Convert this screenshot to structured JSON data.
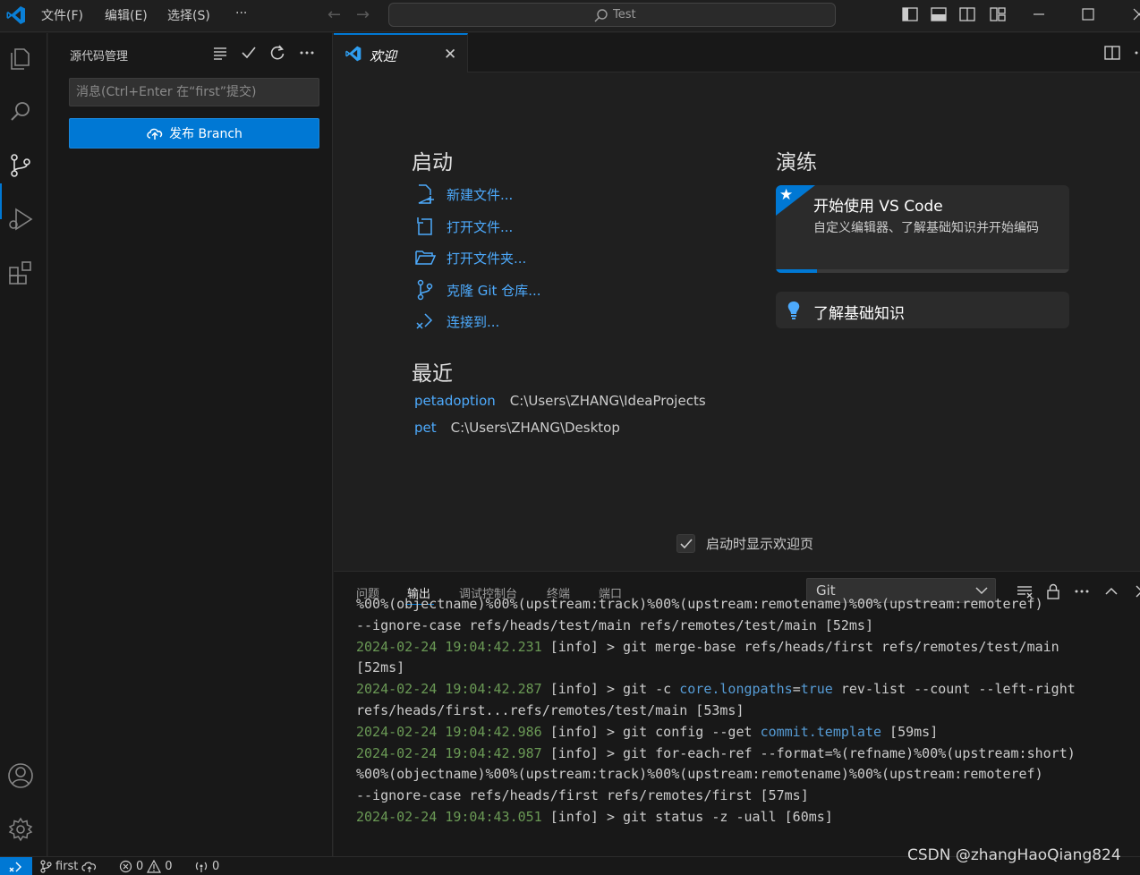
{
  "titlebar": {
    "menu": [
      "文件(F)",
      "编辑(E)",
      "选择(S)",
      "···"
    ],
    "search_text": "Test"
  },
  "sidebar": {
    "title": "源代码管理",
    "message_placeholder": "消息(Ctrl+Enter 在“first”提交)",
    "publish_label": "发布 Branch"
  },
  "tabs": {
    "welcome_label": "欢迎"
  },
  "welcome": {
    "start_title": "启动",
    "start_items": [
      "新建文件...",
      "打开文件...",
      "打开文件夹...",
      "克隆 Git 仓库...",
      "连接到..."
    ],
    "recent_title": "最近",
    "recent": [
      {
        "name": "petadoption",
        "path": "C:\\Users\\ZHANG\\IdeaProjects"
      },
      {
        "name": "pet",
        "path": "C:\\Users\\ZHANG\\Desktop"
      }
    ],
    "walkthrough_title": "演练",
    "walkthrough_card": {
      "title": "开始使用 VS Code",
      "description": "自定义编辑器、了解基础知识并开始编码",
      "progress": 0.14
    },
    "basics_card": {
      "title": "了解基础知识"
    },
    "show_on_startup": "启动时显示欢迎页"
  },
  "panel": {
    "tabs": [
      "问题",
      "输出",
      "调试控制台",
      "终端",
      "端口"
    ],
    "active_tab": "输出",
    "channel": "Git",
    "output_lines": [
      [
        {
          "t": "%00%(objectname)%00%(upstream:track)%00%(upstream:remotename)%00%(upstream:remoteref)",
          "c": ""
        }
      ],
      [
        {
          "t": "--ignore-case refs/heads/test/main refs/remotes/test/main [52ms]",
          "c": ""
        }
      ],
      [
        {
          "t": "2024-02-24 19:04:42.231",
          "c": "ts"
        },
        {
          "t": " [info] > git merge-base refs/heads/first refs/remotes/test/main",
          "c": ""
        }
      ],
      [
        {
          "t": "[52ms]",
          "c": ""
        }
      ],
      [
        {
          "t": "2024-02-24 19:04:42.287",
          "c": "ts"
        },
        {
          "t": " [info] > git -c ",
          "c": ""
        },
        {
          "t": "core.longpaths",
          "c": "kw"
        },
        {
          "t": "=",
          "c": ""
        },
        {
          "t": "true",
          "c": "kw"
        },
        {
          "t": " rev-list --count --left-right",
          "c": ""
        }
      ],
      [
        {
          "t": "refs/heads/first...refs/remotes/test/main [53ms]",
          "c": ""
        }
      ],
      [
        {
          "t": "2024-02-24 19:04:42.986",
          "c": "ts"
        },
        {
          "t": " [info] > git config --get ",
          "c": ""
        },
        {
          "t": "commit.template",
          "c": "kw"
        },
        {
          "t": " [59ms]",
          "c": ""
        }
      ],
      [
        {
          "t": "2024-02-24 19:04:42.987",
          "c": "ts"
        },
        {
          "t": " [info] > git for-each-ref --format=%(refname)%00%(upstream:short)",
          "c": ""
        }
      ],
      [
        {
          "t": "%00%(objectname)%00%(upstream:track)%00%(upstream:remotename)%00%(upstream:remoteref)",
          "c": ""
        }
      ],
      [
        {
          "t": "--ignore-case refs/heads/first refs/remotes/first [57ms]",
          "c": ""
        }
      ],
      [
        {
          "t": "2024-02-24 19:04:43.051",
          "c": "ts"
        },
        {
          "t": " [info] > git status -z -uall [60ms]",
          "c": ""
        }
      ]
    ]
  },
  "statusbar": {
    "branch": "first",
    "errors": "0",
    "warnings": "0",
    "ports": "0"
  },
  "watermark": "CSDN @zhangHaoQiang824",
  "colors": {
    "accent": "#0078d4",
    "link": "#4daafc",
    "timestamp": "#6a9955",
    "keyword": "#569cd6"
  }
}
